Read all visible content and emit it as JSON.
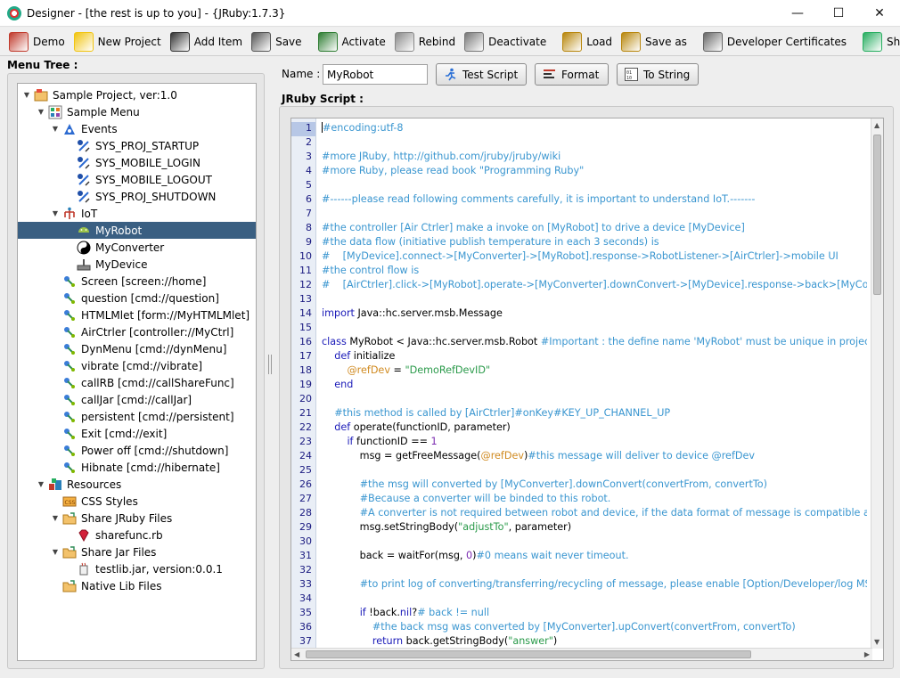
{
  "window": {
    "title": "Designer - [the rest is up to you] - {JRuby:1.7.3}",
    "controls": {
      "minimize": "—",
      "maximize": "☐",
      "close": "✕"
    }
  },
  "toolbar": {
    "items": [
      {
        "label": "Demo",
        "icon": "gift-icon",
        "color": "#c0392b"
      },
      {
        "label": "New Project",
        "icon": "sparkle-icon",
        "color": "#f1c40f"
      },
      {
        "label": "Add Item",
        "icon": "remote-icon",
        "color": "#333333"
      },
      {
        "label": "Save",
        "icon": "floppy-icon",
        "color": "#555555"
      },
      {
        "label": "Activate",
        "icon": "activate-icon",
        "color": "#2e7d32"
      },
      {
        "label": "Rebind",
        "icon": "rebind-icon",
        "color": "#888888"
      },
      {
        "label": "Deactivate",
        "icon": "deactivate-icon",
        "color": "#777777"
      },
      {
        "label": "Load",
        "icon": "load-box-icon",
        "color": "#b8860b"
      },
      {
        "label": "Save as",
        "icon": "saveas-box-icon",
        "color": "#b8860b"
      },
      {
        "label": "Developer Certificates",
        "icon": "certificate-icon",
        "color": "#666666"
      },
      {
        "label": "Shift Project",
        "icon": "shift-grid-icon",
        "color": "#27ae60"
      }
    ]
  },
  "menu_tree": {
    "label": "Menu Tree :",
    "rows": [
      {
        "label": "Sample Project, ver:1.0",
        "level": 0,
        "toggle": "▼",
        "icon": "project-icon"
      },
      {
        "label": "Sample Menu",
        "level": 1,
        "toggle": "▼",
        "icon": "menu-grid-icon"
      },
      {
        "label": "Events",
        "level": 2,
        "toggle": "▼",
        "icon": "events-icon"
      },
      {
        "label": "SYS_PROJ_STARTUP",
        "level": 3,
        "toggle": "",
        "icon": "event-icon"
      },
      {
        "label": "SYS_MOBILE_LOGIN",
        "level": 3,
        "toggle": "",
        "icon": "event-icon"
      },
      {
        "label": "SYS_MOBILE_LOGOUT",
        "level": 3,
        "toggle": "",
        "icon": "event-icon"
      },
      {
        "label": "SYS_PROJ_SHUTDOWN",
        "level": 3,
        "toggle": "",
        "icon": "event-icon"
      },
      {
        "label": "IoT",
        "level": 2,
        "toggle": "▼",
        "icon": "iot-icon"
      },
      {
        "label": "MyRobot",
        "level": 3,
        "toggle": "",
        "icon": "android-robot-icon",
        "selected": true
      },
      {
        "label": "MyConverter",
        "level": 3,
        "toggle": "",
        "icon": "yin-yang-icon"
      },
      {
        "label": "MyDevice",
        "level": 3,
        "toggle": "",
        "icon": "device-icon"
      },
      {
        "label": "Screen [screen://home]",
        "level": 2,
        "toggle": "",
        "icon": "link-icon"
      },
      {
        "label": "question [cmd://question]",
        "level": 2,
        "toggle": "",
        "icon": "link-icon"
      },
      {
        "label": "HTMLMlet [form://MyHTMLMlet]",
        "level": 2,
        "toggle": "",
        "icon": "link-icon"
      },
      {
        "label": "AirCtrler [controller://MyCtrl]",
        "level": 2,
        "toggle": "",
        "icon": "link-icon"
      },
      {
        "label": "DynMenu [cmd://dynMenu]",
        "level": 2,
        "toggle": "",
        "icon": "link-icon"
      },
      {
        "label": "vibrate [cmd://vibrate]",
        "level": 2,
        "toggle": "",
        "icon": "link-icon"
      },
      {
        "label": "callRB [cmd://callShareFunc]",
        "level": 2,
        "toggle": "",
        "icon": "link-icon"
      },
      {
        "label": "callJar [cmd://callJar]",
        "level": 2,
        "toggle": "",
        "icon": "link-icon"
      },
      {
        "label": "persistent [cmd://persistent]",
        "level": 2,
        "toggle": "",
        "icon": "link-icon"
      },
      {
        "label": "Exit [cmd://exit]",
        "level": 2,
        "toggle": "",
        "icon": "link-icon"
      },
      {
        "label": "Power off [cmd://shutdown]",
        "level": 2,
        "toggle": "",
        "icon": "link-icon"
      },
      {
        "label": "Hibnate [cmd://hibernate]",
        "level": 2,
        "toggle": "",
        "icon": "link-icon"
      },
      {
        "label": "Resources",
        "level": 1,
        "toggle": "▼",
        "icon": "resources-icon"
      },
      {
        "label": "CSS Styles",
        "level": 2,
        "toggle": "",
        "icon": "css-icon"
      },
      {
        "label": "Share JRuby Files",
        "level": 2,
        "toggle": "▼",
        "icon": "folder-icon"
      },
      {
        "label": "sharefunc.rb",
        "level": 3,
        "toggle": "",
        "icon": "ruby-gem-icon"
      },
      {
        "label": "Share Jar Files",
        "level": 2,
        "toggle": "▼",
        "icon": "folder-icon"
      },
      {
        "label": "testlib.jar, version:0.0.1",
        "level": 3,
        "toggle": "",
        "icon": "jar-icon"
      },
      {
        "label": "Native Lib Files",
        "level": 2,
        "toggle": "",
        "icon": "folder-icon"
      }
    ]
  },
  "editor": {
    "name_label": "Name :",
    "name_value": "MyRobot",
    "test_script_label": "Test Script",
    "format_label": "Format",
    "to_string_label": "To String",
    "script_label": "JRuby Script :"
  },
  "script": {
    "active_line": 1,
    "lines": [
      [
        [
          "cm",
          "#encoding:utf-8"
        ]
      ],
      [],
      [
        [
          "cm",
          "#more JRuby, http://github.com/jruby/jruby/wiki"
        ]
      ],
      [
        [
          "cm",
          "#more Ruby, please read book \"Programming Ruby\""
        ]
      ],
      [],
      [
        [
          "cm",
          "#------please read following comments carefully, it is important to understand IoT.-------"
        ]
      ],
      [],
      [
        [
          "cm",
          "#the controller [Air Ctrler] make a invoke on [MyRobot] to drive a device [MyDevice]"
        ]
      ],
      [
        [
          "cm",
          "#the data flow (initiative publish temperature in each 3 seconds) is"
        ]
      ],
      [
        [
          "cm",
          "#    [MyDevice].connect->[MyConverter]->[MyRobot].response->RobotListener->[AirCtrler]->mobile UI"
        ]
      ],
      [
        [
          "cm",
          "#the control flow is"
        ]
      ],
      [
        [
          "cm",
          "#    [AirCtrler].click->[MyRobot].operate->[MyConverter].downConvert->[MyDevice].response->back>[MyConverter].u"
        ]
      ],
      [],
      [
        [
          "kw",
          "import"
        ],
        [
          "nm",
          " Java::hc.server.msb.Message"
        ]
      ],
      [],
      [
        [
          "kw",
          "class"
        ],
        [
          "nm",
          " MyRobot < Java::hc.server.msb.Robot "
        ],
        [
          "cm",
          "#Important : the define name 'MyRobot' must be unique in project"
        ]
      ],
      [
        [
          "nm",
          "    "
        ],
        [
          "kw",
          "def"
        ],
        [
          "nm",
          " initialize"
        ]
      ],
      [
        [
          "nm",
          "        "
        ],
        [
          "iv",
          "@refDev"
        ],
        [
          "nm",
          " = "
        ],
        [
          "st",
          "\"DemoRefDevID\""
        ]
      ],
      [
        [
          "nm",
          "    "
        ],
        [
          "kw",
          "end"
        ]
      ],
      [],
      [
        [
          "nm",
          "    "
        ],
        [
          "cm",
          "#this method is called by [AirCtrler]#onKey#KEY_UP_CHANNEL_UP"
        ]
      ],
      [
        [
          "nm",
          "    "
        ],
        [
          "kw",
          "def"
        ],
        [
          "nm",
          " operate(functionID, parameter)"
        ]
      ],
      [
        [
          "nm",
          "        "
        ],
        [
          "kw",
          "if"
        ],
        [
          "nm",
          " functionID == "
        ],
        [
          "nu",
          "1"
        ]
      ],
      [
        [
          "nm",
          "            msg = getFreeMessage("
        ],
        [
          "iv",
          "@refDev"
        ],
        [
          "nm",
          ")"
        ],
        [
          "cm",
          "#this message will deliver to device @refDev"
        ]
      ],
      [],
      [
        [
          "nm",
          "            "
        ],
        [
          "cm",
          "#the msg will converted by [MyConverter].downConvert(convertFrom, convertTo)"
        ]
      ],
      [
        [
          "nm",
          "            "
        ],
        [
          "cm",
          "#Because a converter will be binded to this robot."
        ]
      ],
      [
        [
          "nm",
          "            "
        ],
        [
          "cm",
          "#A converter is not required between robot and device, if the data format of message is compatible and not"
        ]
      ],
      [
        [
          "nm",
          "            msg.setStringBody("
        ],
        [
          "st",
          "\"adjustTo\""
        ],
        [
          "nm",
          ", parameter)"
        ]
      ],
      [],
      [
        [
          "nm",
          "            back = waitFor(msg, "
        ],
        [
          "nu",
          "0"
        ],
        [
          "nm",
          ")"
        ],
        [
          "cm",
          "#0 means wait never timeout."
        ]
      ],
      [],
      [
        [
          "nm",
          "            "
        ],
        [
          "cm",
          "#to print log of converting/transferring/recycling of message, please enable [Option/Developer/log MSB mes"
        ]
      ],
      [],
      [
        [
          "nm",
          "            "
        ],
        [
          "kw",
          "if"
        ],
        [
          "nm",
          " !back."
        ],
        [
          "kw",
          "nil"
        ],
        [
          "nm",
          "?"
        ],
        [
          "cm",
          "# back != null"
        ]
      ],
      [
        [
          "nm",
          "                "
        ],
        [
          "cm",
          "#the back msg was converted by [MyConverter].upConvert(convertFrom, convertTo)"
        ]
      ],
      [
        [
          "nm",
          "                "
        ],
        [
          "kw",
          "return"
        ],
        [
          "nm",
          " back.getStringBody("
        ],
        [
          "st",
          "\"answer\""
        ],
        [
          "nm",
          ")"
        ]
      ]
    ]
  },
  "colors": {
    "selection": "#3a5f82",
    "comment": "#3a96d0",
    "keyword": "#1a1ab8",
    "instance_var": "#d08a20",
    "string": "#2a9a4a"
  }
}
